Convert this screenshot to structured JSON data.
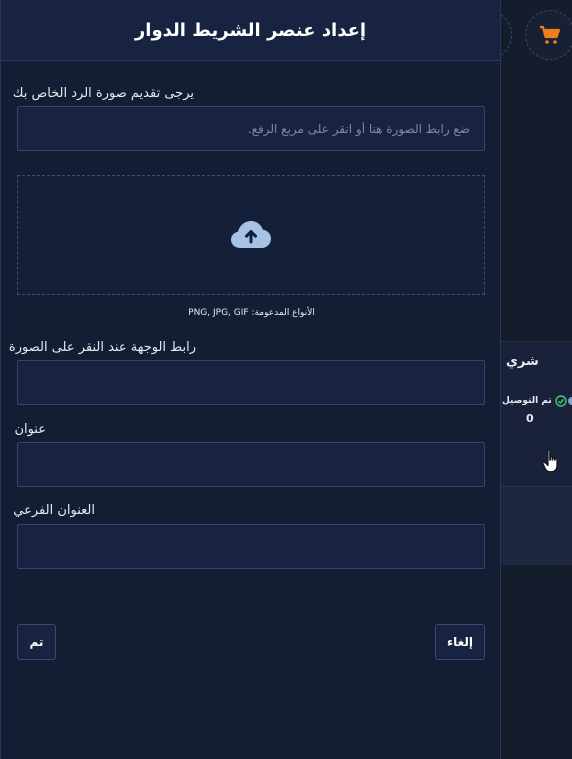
{
  "modal": {
    "title": "إعداد عنصر الشريط الدوار",
    "image_label": "يرجى تقديم صورة الرد الخاص بك",
    "image_placeholder": "ضع رابط الصورة هنا أو انقر على مربع الرفع.",
    "supported_types": "الأنواع المدعومة: PNG, JPG, GIF",
    "link_label": "رابط الوجهة عند النقر على الصورة",
    "link_value": "",
    "title_label": "عنوان",
    "title_value": "",
    "subtitle_label": "العنوان الفرعي",
    "subtitle_value": "",
    "cancel_label": "إلغاء",
    "done_label": "تم"
  },
  "background": {
    "card_title": "شري",
    "status_label": "تم التوصيل",
    "status_count": "0"
  },
  "icons": {
    "cart": "cart-icon",
    "upload": "cloud-upload-icon",
    "check": "check-circle-icon",
    "cursor": "hand-pointer-icon"
  },
  "colors": {
    "accent_orange": "#f07c1a",
    "status_green": "#3ecf6e",
    "panel": "#131d33",
    "input_bg": "#172340"
  }
}
